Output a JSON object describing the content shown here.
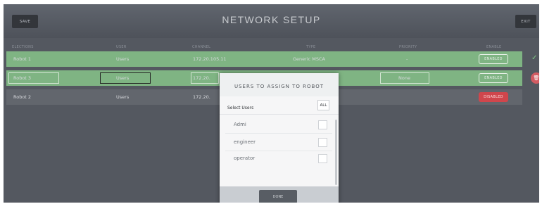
{
  "header": {
    "title": "NETWORK SETUP",
    "left_button": "SAVE",
    "right_button": "EXIT"
  },
  "columns": [
    "ELECTIONS",
    "USER",
    "CHANNEL",
    "TYPE",
    "PRIORITY",
    "ENABLE"
  ],
  "rows": [
    {
      "name": "Robot 1",
      "user": "Users",
      "ip": "172.20.105.11",
      "type": "Generic MSCA",
      "priority": "-",
      "status": "ENABLED"
    },
    {
      "name": "Robot 3",
      "user": "Users",
      "ip": "172.20.",
      "type": "",
      "priority": "None",
      "status": "ENABLED"
    },
    {
      "name": "Robot 2",
      "user": "Users",
      "ip": "172.20.",
      "type": "",
      "priority": "",
      "status": "DISABLED"
    }
  ],
  "modal": {
    "title": "USERS TO ASSIGN TO ROBOT",
    "select_label": "Select Users",
    "all_label": "ALL",
    "users": [
      "Admi",
      "engineer",
      "operator"
    ],
    "done_label": "DONE"
  },
  "icons": {
    "check": "check-icon",
    "trash": "trash-icon"
  },
  "colors": {
    "row_green": "#7fb483",
    "disabled": "#d0464c",
    "background": "#545860"
  }
}
